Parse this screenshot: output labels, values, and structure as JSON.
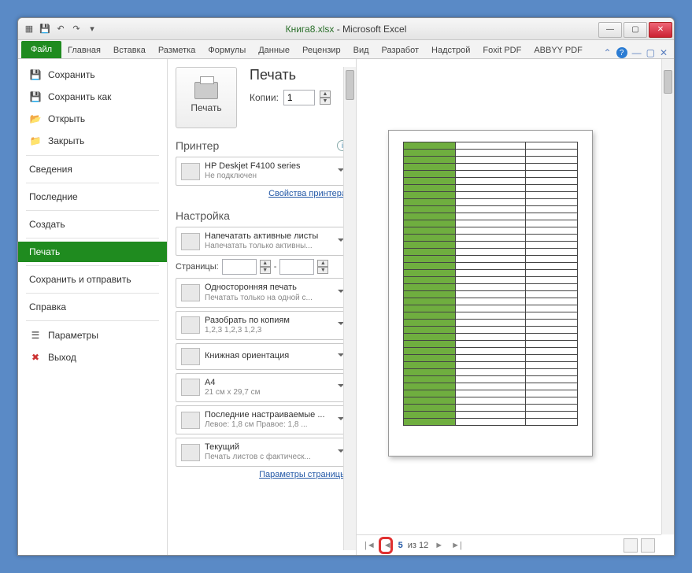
{
  "window": {
    "filename": "Книга8.xlsx",
    "app": "Microsoft Excel",
    "sep": " - "
  },
  "ribbon": {
    "file": "Файл",
    "tabs": [
      "Главная",
      "Вставка",
      "Разметка",
      "Формулы",
      "Данные",
      "Рецензир",
      "Вид",
      "Разработ",
      "Надстрой",
      "Foxit PDF",
      "ABBYY PDF"
    ]
  },
  "nav": {
    "save": "Сохранить",
    "save_as": "Сохранить как",
    "open": "Открыть",
    "close": "Закрыть",
    "info": "Сведения",
    "recent": "Последние",
    "new": "Создать",
    "print": "Печать",
    "share": "Сохранить и отправить",
    "help": "Справка",
    "options": "Параметры",
    "exit": "Выход"
  },
  "print": {
    "header": "Печать",
    "button": "Печать",
    "copies_label": "Копии:",
    "copies_value": "1",
    "printer_section": "Принтер",
    "printer_name": "HP Deskjet F4100 series",
    "printer_status": "Не подключен",
    "printer_props": "Свойства принтера",
    "settings_section": "Настройка",
    "s1_t": "Напечатать активные листы",
    "s1_d": "Напечатать только активны...",
    "pages_label": "Страницы:",
    "pages_dash": "-",
    "s2_t": "Односторонняя печать",
    "s2_d": "Печатать только на одной с...",
    "s3_t": "Разобрать по копиям",
    "s3_d": "1,2,3   1,2,3   1,2,3",
    "s4_t": "Книжная ориентация",
    "s5_t": "A4",
    "s5_d": "21 см x 29,7 см",
    "s6_t": "Последние настраиваемые ...",
    "s6_d": "Левое: 1,8 см   Правое: 1,8 ...",
    "s7_t": "Текущий",
    "s7_d": "Печать листов с фактическ...",
    "page_setup": "Параметры страницы"
  },
  "status": {
    "page_current": "5",
    "page_of": "из 12",
    "prev": "◄",
    "next": "►",
    "first": "|◄",
    "last": "►|"
  },
  "preview_rows": 40
}
